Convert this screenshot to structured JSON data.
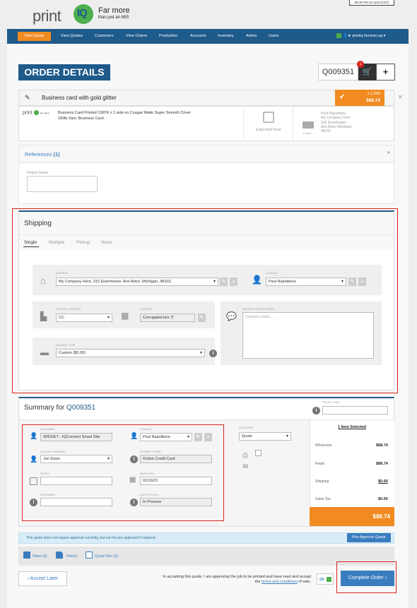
{
  "header": {
    "clock": "06:40 PM 22 April (CDT)",
    "logo": {
      "word": "print",
      "mark": "IQ",
      "tagline1": "Far more",
      "tagline2": "than just an MIS"
    }
  },
  "nav": {
    "start": "Start Quote",
    "items": [
      "View Quotes",
      "Customers",
      "View Orders",
      "Production",
      "Accounts",
      "Inventory",
      "Admin",
      "Users"
    ],
    "user": "printiq.herman.ng ▾"
  },
  "order": {
    "title": "ORDER DETAILS",
    "quote": "Q009351",
    "cart_count": "1",
    "plus": "+"
  },
  "item": {
    "name": "Business card with gold glitter",
    "qty": "x 1,000",
    "price": "$88.74",
    "mini_logo": "print",
    "mini_tag": "far more",
    "description": "Business Card Printed CMYK x 1 side on Cougar Matte Super Smooth Cover 100lb Size: Business Card",
    "expected_label": "Expected Date",
    "expected_value": "...",
    "delivery_days": "2 days",
    "delivery_address": [
      "Paul Napolitano",
      "My Company Here",
      "315 Eisenhower",
      "Ann Arbor Michigan",
      "48103"
    ]
  },
  "references": {
    "label": "References",
    "count": "(1)",
    "project_label": "Project Name"
  },
  "shipping": {
    "title": "Shipping",
    "tabs": [
      "Single",
      "Multiple",
      "Pickup",
      "None"
    ],
    "address_label": "ADDRESS",
    "address_value": "My Company Here, 315 Eisenhower, Ann Arbor, Michigan, 48103,",
    "contact_label": "CONTACT",
    "contact_value": "Paul Napolitano",
    "factory_label": "FACTORY LOCATION",
    "factory_value": "CC",
    "cartons_label": "CARTONS",
    "cartons_value": "Corrugated box 3\"",
    "delivery_instr_label": "DELIVERY INSTRUCTIONS",
    "delivery_instr_placeholder": "Delivery notes...",
    "delivery_type_label": "DELIVERY TYPE",
    "delivery_type_value": "Custom ($0.00)"
  },
  "summary": {
    "title": "Summary for",
    "quote": "Q009351",
    "promo_label": "PROMO CODE",
    "customer_label": "CUSTOMER",
    "customer_value": "WIDGET - IQConnect Smart Site",
    "contact_label": "CONTACT",
    "contact_value": "Paul Napolitano",
    "manager_label": "ACCOUNT MANAGER",
    "manager_value": "Jon Davis",
    "payment_label": "PAYMENT TERMS",
    "payment_value": "Online Credit Card",
    "notes_label": "NOTES",
    "valid_label": "VALID UNTIL",
    "valid_value": "02/16/21",
    "po_label": "PO NUMBER",
    "status_label": "QUOTE STATUS",
    "status_value": "In Process",
    "pdf_label": "QUOTE PDF",
    "pdf_value": "Quote",
    "selected": "1 Item Selected",
    "rows": [
      {
        "label": "Wholesale",
        "value": "$88.74"
      },
      {
        "label": "Retail",
        "value": "$88.74"
      },
      {
        "label": "Shipping",
        "value": "$0.00"
      },
      {
        "label": "Sales Tax",
        "value": "$0.00"
      }
    ],
    "total": "$88.74"
  },
  "approval": {
    "text": "This quote does not require approval currently, but can be pre-approved if required.",
    "button": "Pre-Approve Quote"
  },
  "links": {
    "notes": "Notes (6)",
    "history": "History",
    "files": "Quote Files (6)"
  },
  "footer": {
    "accept_later": "Accept Later",
    "note_1": "In accepting this quote, I am approving the job to be printed and have read and accept the",
    "terms": "terms and conditions",
    "note_2": "of sale.",
    "complete": "Complete Order"
  },
  "colors": {
    "brand": "#1e5a8a",
    "accent": "#f18b21",
    "link": "#3a7dbf",
    "highlight": "#d9241c"
  }
}
